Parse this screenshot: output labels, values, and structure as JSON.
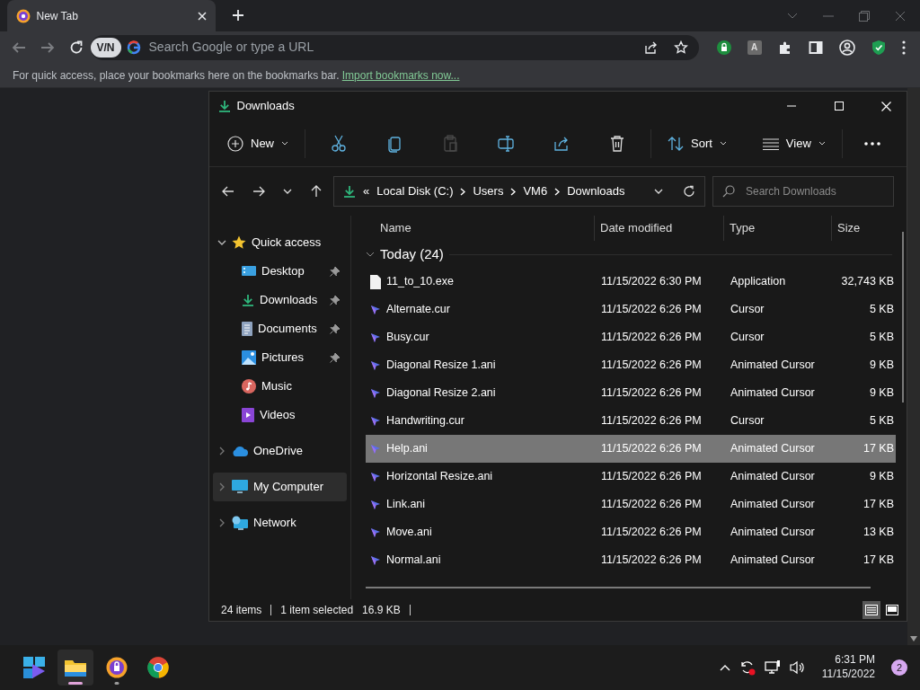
{
  "browser": {
    "tab": {
      "title": "New Tab"
    },
    "vpn_badge": "V/N",
    "address": {
      "placeholder": "Search Google or type a URL"
    },
    "extension_badge": "A",
    "bookmarks_bar": {
      "text": "For quick access, place your bookmarks here on the bookmarks bar.",
      "link": "Import bookmarks now..."
    }
  },
  "explorer": {
    "window": {
      "title": "Downloads"
    },
    "command_bar": {
      "new_button": "New",
      "actions": [
        {
          "disabled": false
        },
        {
          "disabled": false
        },
        {
          "disabled": true
        },
        {
          "disabled": false
        },
        {
          "disabled": false
        },
        {
          "disabled": false
        }
      ],
      "sort_button": "Sort",
      "view_button": "View"
    },
    "address_bar": {
      "overflow": "«",
      "breadcrumbs": [
        "Local Disk (C:)",
        "Users",
        "VM6",
        "Downloads"
      ]
    },
    "search": {
      "placeholder": "Search Downloads"
    },
    "sidebar": {
      "items": [
        {
          "label": "Quick access",
          "expanded": true,
          "selected": false,
          "children": [
            {
              "label": "Desktop",
              "pinned": true,
              "selected": false
            },
            {
              "label": "Downloads",
              "pinned": true,
              "selected": false
            },
            {
              "label": "Documents",
              "pinned": true,
              "selected": false
            },
            {
              "label": "Pictures",
              "pinned": true,
              "selected": false
            },
            {
              "label": "Music",
              "pinned": false,
              "selected": false
            },
            {
              "label": "Videos",
              "pinned": false,
              "selected": false
            }
          ]
        },
        {
          "label": "OneDrive",
          "expanded": false,
          "selected": false
        },
        {
          "label": "My Computer",
          "expanded": false,
          "selected": true
        },
        {
          "label": "Network",
          "expanded": false,
          "selected": false
        }
      ]
    },
    "table": {
      "columns": [
        "Name",
        "Date modified",
        "Type",
        "Size"
      ],
      "group": {
        "label": "Today (24)",
        "expanded": true
      },
      "rows": [
        {
          "name": "11_to_10.exe",
          "date": "11/15/2022 6:30 PM",
          "type": "Application",
          "size": "32,743 KB",
          "selected": false
        },
        {
          "name": "Alternate.cur",
          "date": "11/15/2022 6:26 PM",
          "type": "Cursor",
          "size": "5 KB",
          "selected": false
        },
        {
          "name": "Busy.cur",
          "date": "11/15/2022 6:26 PM",
          "type": "Cursor",
          "size": "5 KB",
          "selected": false
        },
        {
          "name": "Diagonal Resize 1.ani",
          "date": "11/15/2022 6:26 PM",
          "type": "Animated Cursor",
          "size": "9 KB",
          "selected": false
        },
        {
          "name": "Diagonal Resize 2.ani",
          "date": "11/15/2022 6:26 PM",
          "type": "Animated Cursor",
          "size": "9 KB",
          "selected": false
        },
        {
          "name": "Handwriting.cur",
          "date": "11/15/2022 6:26 PM",
          "type": "Cursor",
          "size": "5 KB",
          "selected": false
        },
        {
          "name": "Help.ani",
          "date": "11/15/2022 6:26 PM",
          "type": "Animated Cursor",
          "size": "17 KB",
          "selected": true
        },
        {
          "name": "Horizontal Resize.ani",
          "date": "11/15/2022 6:26 PM",
          "type": "Animated Cursor",
          "size": "9 KB",
          "selected": false
        },
        {
          "name": "Link.ani",
          "date": "11/15/2022 6:26 PM",
          "type": "Animated Cursor",
          "size": "17 KB",
          "selected": false
        },
        {
          "name": "Move.ani",
          "date": "11/15/2022 6:26 PM",
          "type": "Animated Cursor",
          "size": "13 KB",
          "selected": false
        },
        {
          "name": "Normal.ani",
          "date": "11/15/2022 6:26 PM",
          "type": "Animated Cursor",
          "size": "17 KB",
          "selected": false
        }
      ]
    },
    "status_bar": {
      "item_count": "24 items",
      "selection": "1 item selected",
      "selection_size": "16.9 KB",
      "views": [
        {
          "selected": true
        },
        {
          "selected": false
        }
      ]
    }
  },
  "taskbar": {
    "apps": [
      {
        "active": false,
        "running": false
      },
      {
        "active": true,
        "running": true
      },
      {
        "active": false,
        "running": true
      },
      {
        "active": false,
        "running": false
      }
    ],
    "time": "6:31 PM",
    "date": "11/15/2022",
    "notification_count": "2"
  }
}
